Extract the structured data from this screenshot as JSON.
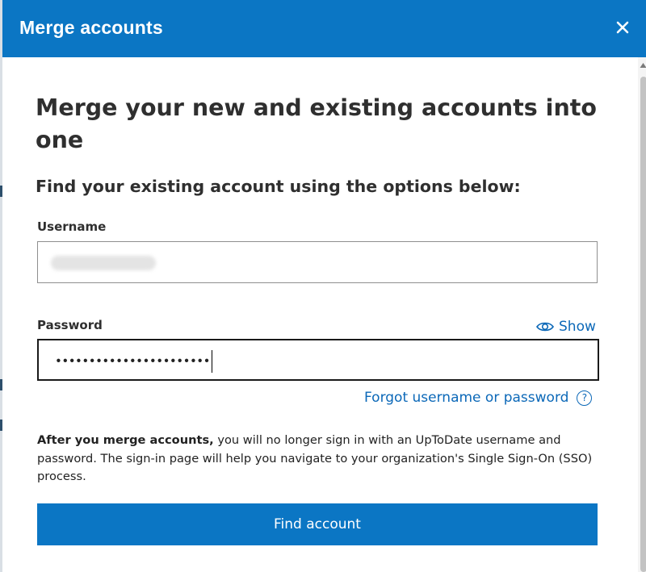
{
  "dialog": {
    "title": "Merge accounts"
  },
  "content": {
    "heading": "Merge your new and existing accounts into one",
    "subheading": "Find your existing account using the options below:"
  },
  "form": {
    "username_label": "Username",
    "username_value": "",
    "password_label": "Password",
    "password_value": "•••••••••••••••••••••••",
    "show_label": "Show",
    "forgot_label": "Forgot username or password",
    "help_glyph": "?"
  },
  "notice": {
    "bold": "After you merge accounts,",
    "text": " you will no longer sign in with an UpToDate username and password. The sign-in page will help you navigate to your organization's Single Sign-On (SSO) process."
  },
  "actions": {
    "find_account_label": "Find account"
  },
  "colors": {
    "accent": "#0b76c4",
    "link": "#0b68b8"
  },
  "icons": [
    "close-icon",
    "eye-icon",
    "help-icon",
    "scroll-up-arrow-icon"
  ]
}
